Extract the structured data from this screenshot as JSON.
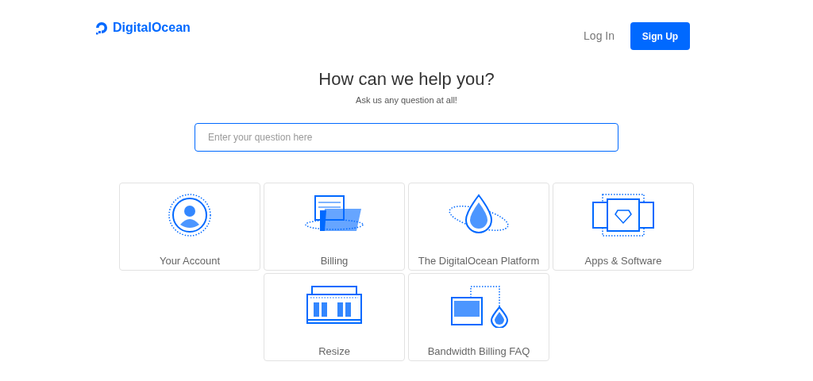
{
  "header": {
    "logo": "DigitalOcean",
    "login": "Log In",
    "signup": "Sign Up"
  },
  "hero": {
    "title": "How can we help you?",
    "subtitle": "Ask us any question at all!"
  },
  "search": {
    "placeholder": "Enter your question here"
  },
  "categories": [
    {
      "label": "Your Account",
      "kind": "account"
    },
    {
      "label": "Billing",
      "kind": "billing"
    },
    {
      "label": "The DigitalOcean Platform",
      "kind": "platform"
    },
    {
      "label": "Apps & Software",
      "kind": "apps"
    },
    {
      "label": "Resize",
      "kind": "resize"
    },
    {
      "label": "Bandwidth Billing FAQ",
      "kind": "bandwidth"
    }
  ]
}
